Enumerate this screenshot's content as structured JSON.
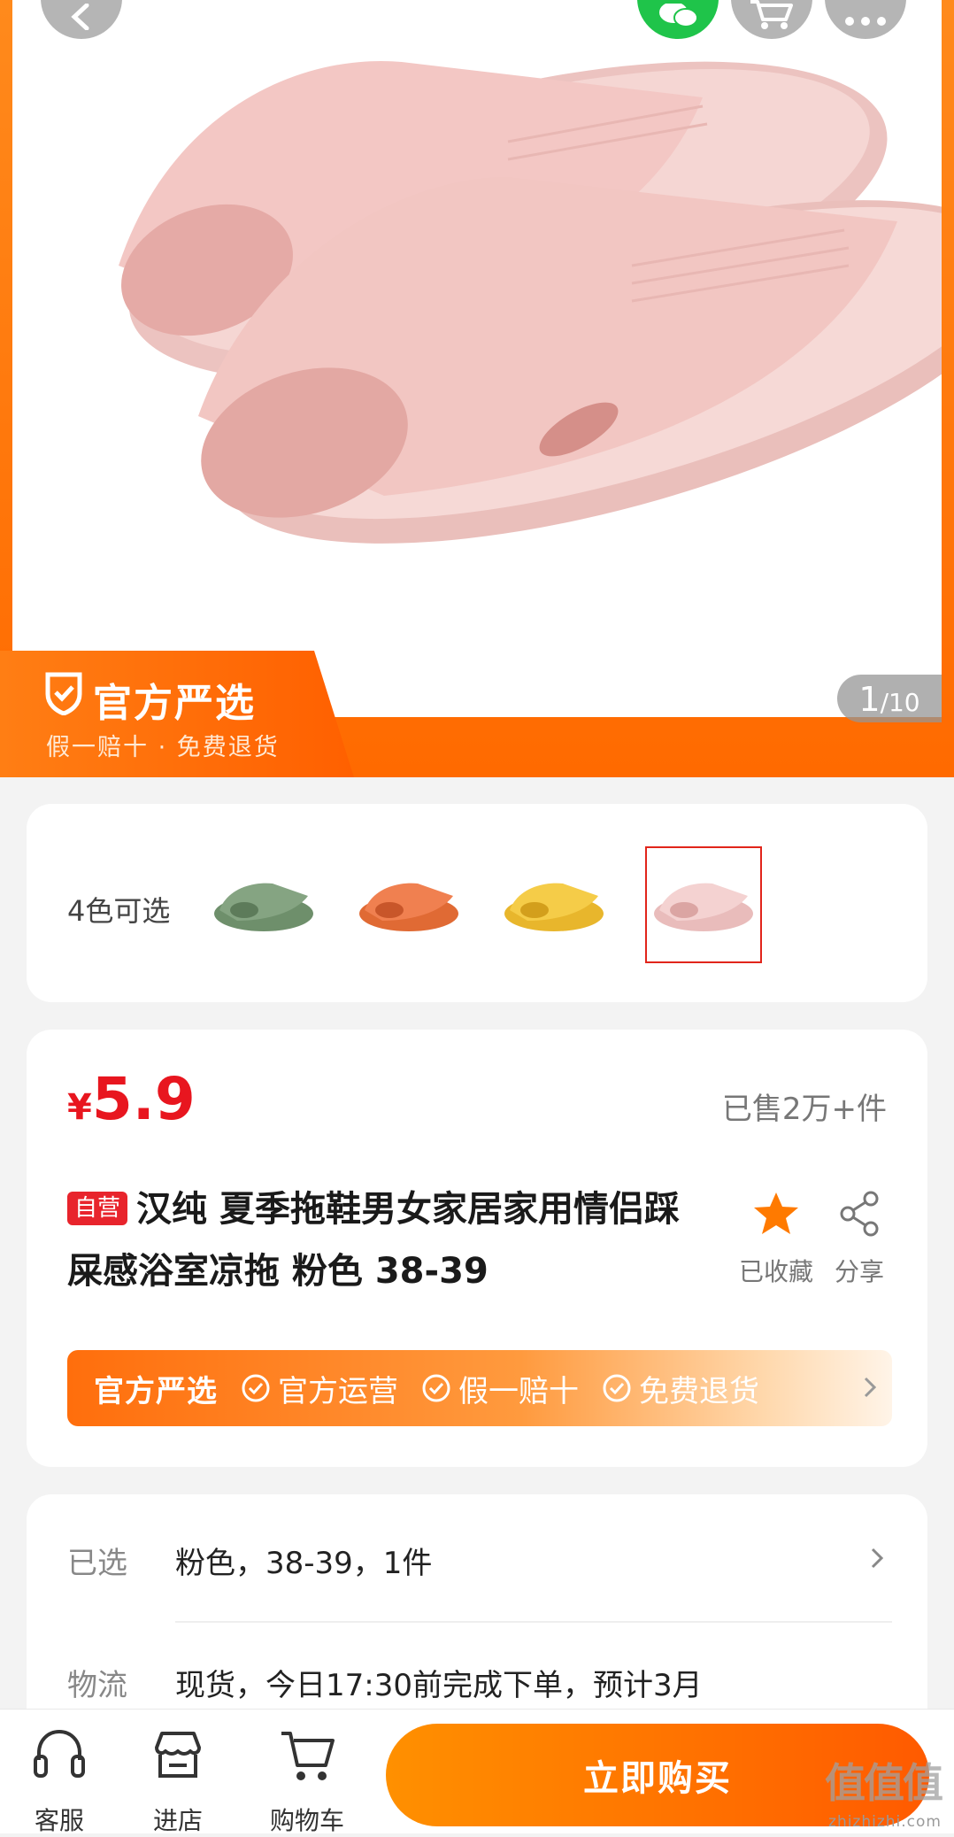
{
  "hero": {
    "banner_title": "官方严选",
    "banner_subtitle": "假一赔十 · 免费退货",
    "page_current": "1",
    "page_total": "/10",
    "product_color": "#f3c7c4"
  },
  "colors": {
    "label": "4色可选",
    "swatches": [
      {
        "name": "green",
        "color": "#7fa07c"
      },
      {
        "name": "orange",
        "color": "#ef7a42"
      },
      {
        "name": "yellow",
        "color": "#f2c43d"
      },
      {
        "name": "pink",
        "color": "#f0c9c8",
        "selected": true
      }
    ]
  },
  "product": {
    "currency": "¥",
    "price": "5.9",
    "sold": "已售2万+件",
    "self_tag": "自营",
    "title": "汉纯 夏季拖鞋男女家居家用情侣踩屎感浴室凉拖 粉色 38-39",
    "favorite_label": "已收藏",
    "share_label": "分享"
  },
  "official_bar": {
    "lead": "官方严选",
    "items": [
      "官方运营",
      "假一赔十",
      "免费退货"
    ]
  },
  "selection": {
    "selected_label": "已选",
    "selected_value": "粉色，38-39，1件",
    "logistics_label": "物流",
    "logistics_value": "现货，今日17:30前完成下单，预计3月"
  },
  "bottom_bar": {
    "service": "客服",
    "store": "进店",
    "cart": "购物车",
    "buy": "立即购买"
  },
  "watermark": {
    "mark": "值值值",
    "domain": "zhizhizhi.com"
  },
  "colors_theme": {
    "accent": "#ff6a00",
    "price_red": "#e8161f"
  }
}
